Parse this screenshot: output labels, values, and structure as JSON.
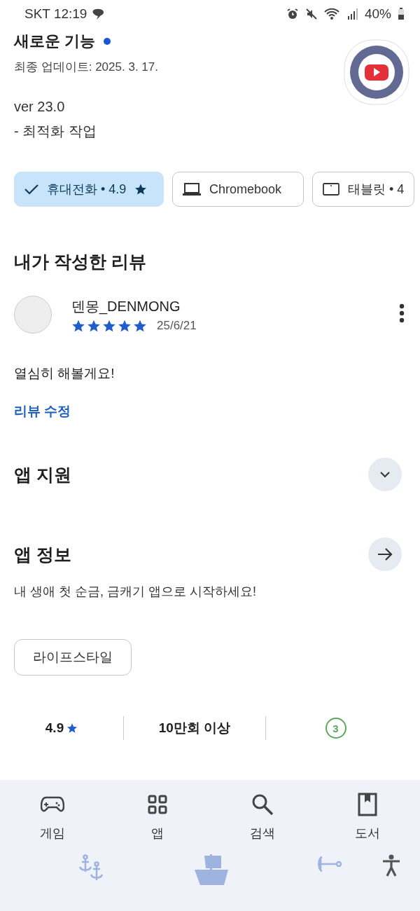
{
  "status_bar": {
    "carrier_time": "SKT 12:19",
    "battery": "40%"
  },
  "whats_new": {
    "title": "새로운 기능",
    "updated": "최종 업데이트: 2025. 3. 17.",
    "notes": [
      "ver 23.0",
      "- 최적화 작업"
    ]
  },
  "device_chips": [
    {
      "label": "휴대전화 • 4.9",
      "star": true,
      "selected": true
    },
    {
      "kind": "laptop",
      "label": "Chromebook",
      "star": false,
      "selected": false
    },
    {
      "kind": "tablet",
      "label": "태블릿 • 4",
      "star": false,
      "selected": false
    }
  ],
  "my_review": {
    "heading": "내가 작성한 리뷰",
    "author": "덴몽_DENMONG",
    "stars": 5,
    "date": "25/6/21",
    "text": "열심히 해볼게요!",
    "edit_link": "리뷰 수정"
  },
  "sections": [
    {
      "kind": "expand",
      "title": "앱 지원",
      "expanded": false
    },
    {
      "kind": "arrow",
      "title": "앱 정보"
    }
  ],
  "about_text": "내 생애 첫 순금, 금캐기 앱으로 시작하세요!",
  "category_chip": "라이프스타일",
  "stats": [
    {
      "kind": "rating",
      "value": "4.9"
    },
    {
      "kind": "downloads",
      "value": "10만회 이상"
    },
    {
      "kind": "age",
      "value": "3"
    }
  ],
  "bottom_nav": [
    {
      "label": "게임",
      "selected": false
    },
    {
      "label": "앱",
      "selected": false
    },
    {
      "label": "검색",
      "selected": false
    },
    {
      "label": "도서",
      "selected": false
    }
  ]
}
